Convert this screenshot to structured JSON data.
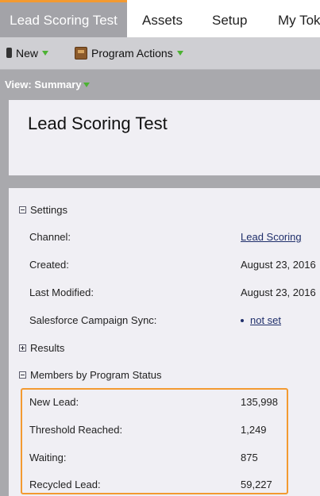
{
  "nav": {
    "tabs": [
      {
        "label": "Lead Scoring Test"
      },
      {
        "label": "Assets"
      },
      {
        "label": "Setup"
      },
      {
        "label": "My Tok"
      }
    ]
  },
  "toolbar": {
    "new_label": "New",
    "program_actions_label": "Program Actions"
  },
  "view": {
    "label": "View: Summary"
  },
  "program": {
    "title": "Lead Scoring Test"
  },
  "settings": {
    "heading": "Settings",
    "rows": [
      {
        "label": "Channel:",
        "value": "Lead Scoring"
      },
      {
        "label": "Created:",
        "value": "August 23, 2016"
      },
      {
        "label": "Last Modified:",
        "value": "August 23, 2016"
      },
      {
        "label": "Salesforce Campaign Sync:",
        "value": "not set"
      }
    ]
  },
  "results": {
    "heading": "Results"
  },
  "members": {
    "heading": "Members by Program Status",
    "rows": [
      {
        "label": "New Lead:",
        "value": "135,998"
      },
      {
        "label": "Threshold Reached:",
        "value": "1,249"
      },
      {
        "label": "Waiting:",
        "value": "875"
      },
      {
        "label": "Recycled Lead:",
        "value": "59,227"
      }
    ]
  },
  "colors": {
    "accent": "#f39a31",
    "caret_green": "#4cb233",
    "link": "#1f2f6b"
  }
}
